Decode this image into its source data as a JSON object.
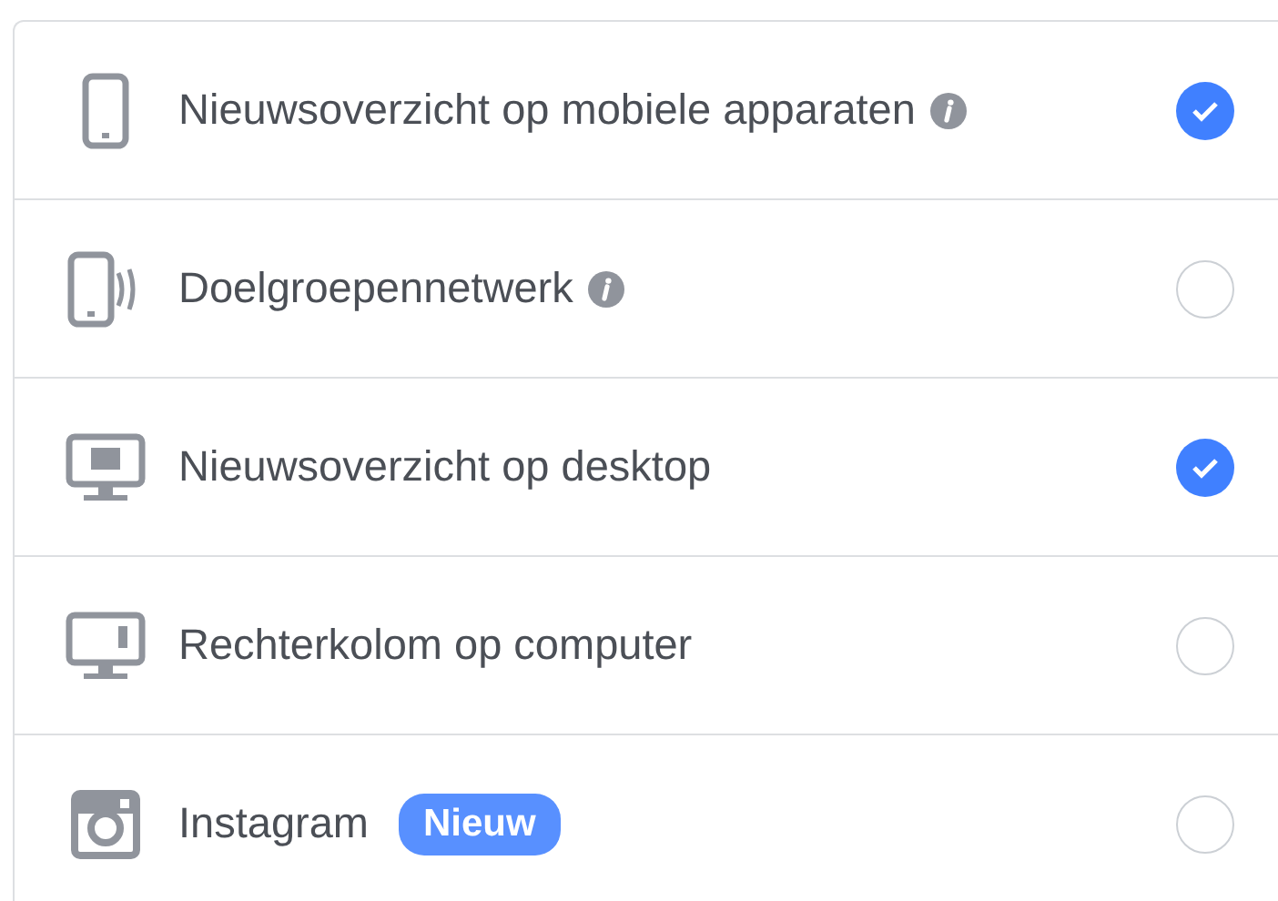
{
  "placements": [
    {
      "kind": "phone",
      "label": "Nieuwsoverzicht op mobiele apparaten",
      "info": true,
      "checked": true
    },
    {
      "kind": "phone-network",
      "label": "Doelgroepennetwerk",
      "info": true,
      "checked": false
    },
    {
      "kind": "desktop-feed",
      "label": "Nieuwsoverzicht op desktop",
      "info": false,
      "checked": true
    },
    {
      "kind": "desktop-side",
      "label": "Rechterkolom op computer",
      "info": false,
      "checked": false
    },
    {
      "kind": "instagram",
      "label": "Instagram",
      "info": false,
      "badge": "Nieuw",
      "checked": false
    }
  ]
}
